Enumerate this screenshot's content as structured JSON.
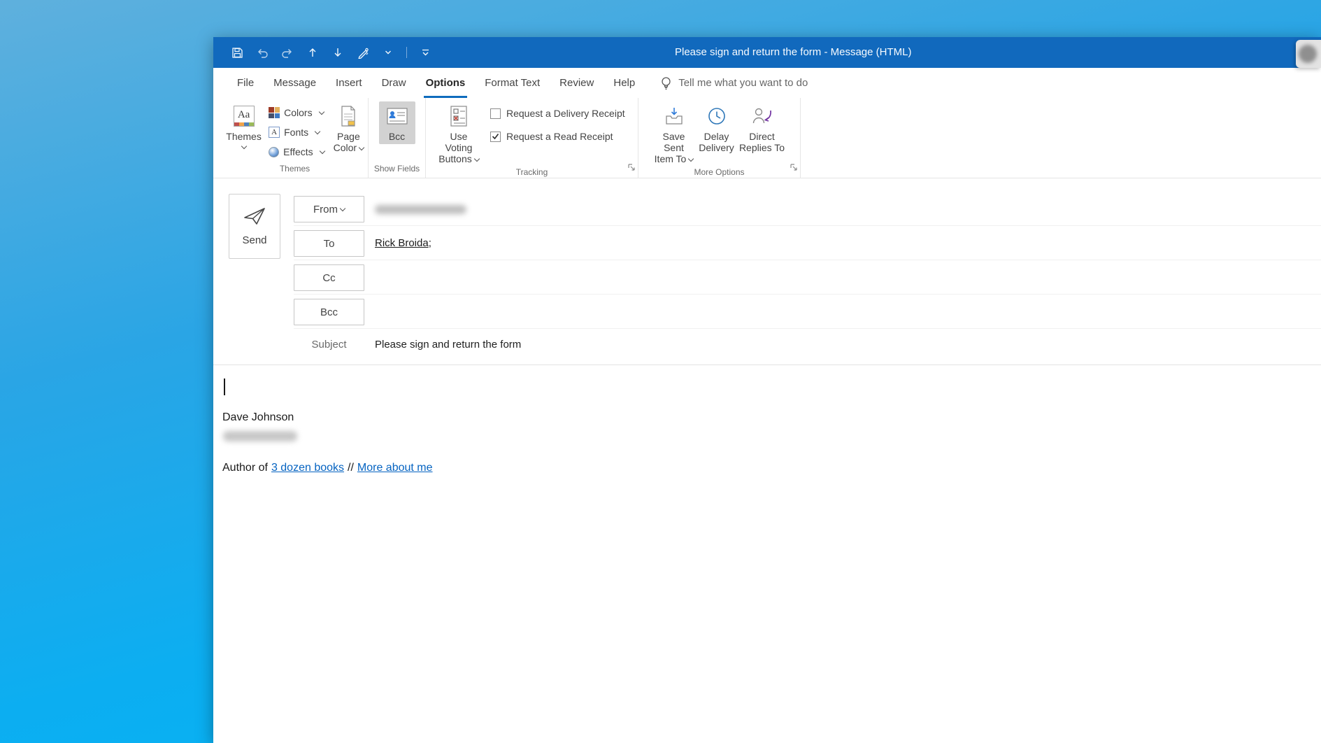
{
  "titlebar": {
    "title": "Please sign and return the form  -  Message (HTML)"
  },
  "tabs": {
    "items": [
      "File",
      "Message",
      "Insert",
      "Draw",
      "Options",
      "Format Text",
      "Review",
      "Help"
    ],
    "selected": "Options",
    "tell_me": "Tell me what you want to do"
  },
  "ribbon": {
    "groups": {
      "themes": {
        "label": "Themes",
        "themes_button": "Themes",
        "colors": "Colors",
        "fonts": "Fonts",
        "effects": "Effects",
        "page_color_line1": "Page",
        "page_color_line2": "Color"
      },
      "show_fields": {
        "label": "Show Fields",
        "bcc": "Bcc",
        "bcc_active": true
      },
      "tracking": {
        "label": "Tracking",
        "voting_line1": "Use Voting",
        "voting_line2": "Buttons",
        "delivery_receipt": "Request a Delivery Receipt",
        "delivery_receipt_checked": false,
        "read_receipt": "Request a Read Receipt",
        "read_receipt_checked": true
      },
      "more_options": {
        "label": "More Options",
        "save_line1": "Save Sent",
        "save_line2": "Item To",
        "delay_line1": "Delay",
        "delay_line2": "Delivery",
        "direct_line1": "Direct",
        "direct_line2": "Replies To"
      }
    }
  },
  "composer": {
    "send": "Send",
    "from_label": "From",
    "to_label": "To",
    "cc_label": "Cc",
    "bcc_label": "Bcc",
    "to_recipient": "Rick Broida",
    "to_separator": ";",
    "subject_label": "Subject",
    "subject_value": "Please sign and return the form"
  },
  "message_body": {
    "signature_name": "Dave Johnson",
    "author_prefix": "Author of",
    "books_link": "3 dozen books",
    "link_separator": "//",
    "about_link": "More about me"
  },
  "icons": {
    "quick_access": [
      "save-icon",
      "undo-icon",
      "redo-icon",
      "arrow-up-icon",
      "arrow-down-icon",
      "pen-icon",
      "customize-qat-icon"
    ],
    "other": [
      "lightbulb-icon",
      "send-paper-plane-icon",
      "themes-icon",
      "colors-icon",
      "fonts-icon",
      "effects-icon",
      "page-color-icon",
      "bcc-fields-icon",
      "voting-buttons-icon",
      "save-sent-icon",
      "delay-clock-icon",
      "direct-replies-icon",
      "dialog-launcher-icon",
      "checkmark-icon"
    ]
  },
  "colors": {
    "titlebar_blue": "#1169bd",
    "tab_underline": "#0f6cbd",
    "link_blue": "#0563c1"
  }
}
